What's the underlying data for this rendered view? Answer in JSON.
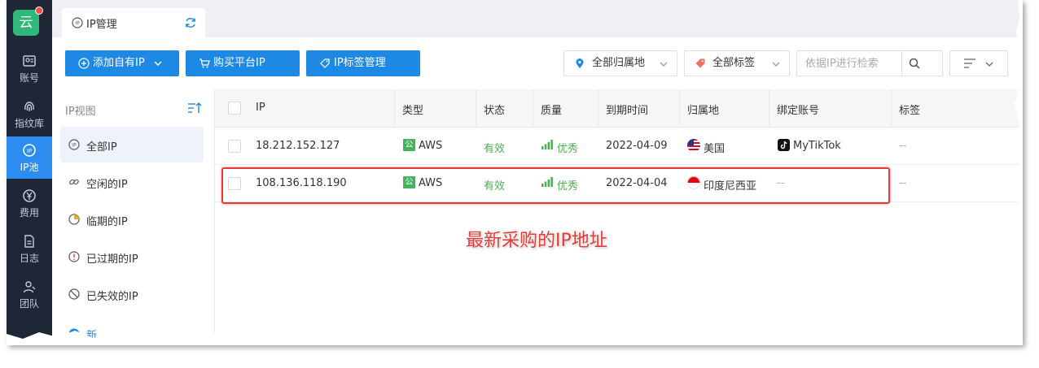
{
  "app": {
    "logo_char": "云"
  },
  "nav": {
    "items": [
      {
        "label": "账号",
        "icon": "account-icon"
      },
      {
        "label": "指纹库",
        "icon": "fingerprint-icon"
      },
      {
        "label": "IP池",
        "icon": "ip-pool-icon",
        "active": true
      },
      {
        "label": "费用",
        "icon": "yen-icon"
      },
      {
        "label": "日志",
        "icon": "log-icon"
      },
      {
        "label": "团队",
        "icon": "team-icon"
      }
    ]
  },
  "tab": {
    "label": "IP管理"
  },
  "toolbar": {
    "add_ip_label": "添加自有IP",
    "buy_ip_label": "购买平台IP",
    "ip_tags_label": "IP标签管理",
    "region_select": "全部归属地",
    "tag_select": "全部标签",
    "search_placeholder": "依据IP进行检索"
  },
  "panel": {
    "title": "IP视图",
    "items": [
      {
        "label": "全部IP",
        "active": true
      },
      {
        "label": "空闲的IP"
      },
      {
        "label": "临期的IP"
      },
      {
        "label": "已过期的IP"
      },
      {
        "label": "已失效的IP"
      }
    ],
    "new_view_label": "新视图"
  },
  "table": {
    "columns": [
      "IP",
      "类型",
      "状态",
      "质量",
      "到期时间",
      "归属地",
      "绑定账号",
      "标签"
    ],
    "rows": [
      {
        "ip": "18.212.152.127",
        "type_badge": "公",
        "type": "AWS",
        "status": "有效",
        "quality": "优秀",
        "expiry": "2022-04-09",
        "region": "美国",
        "account": "MyTikTok",
        "tag": "--"
      },
      {
        "ip": "108.136.118.190",
        "type_badge": "公",
        "type": "AWS",
        "status": "有效",
        "quality": "优秀",
        "expiry": "2022-04-04",
        "region": "印度尼西亚",
        "account": "--",
        "tag": "--"
      }
    ]
  },
  "annotation": "最新采购的IP地址",
  "colors": {
    "primary": "#1e88e5",
    "nav_bg": "#1f2636",
    "active_nav": "#2d8cf0",
    "green": "#4caf50",
    "annotation_red": "#e53935"
  }
}
